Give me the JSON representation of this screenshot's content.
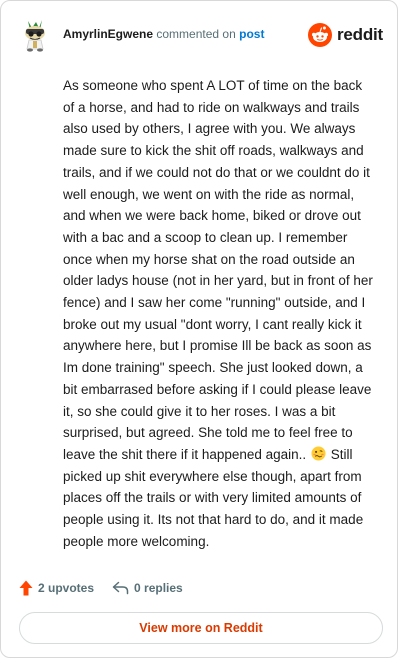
{
  "header": {
    "username": "AmyrlinEgwene",
    "action_text": "commented on",
    "post_link": "post",
    "brand_name": "reddit",
    "brand_color": "#ff4500"
  },
  "avatar": {
    "icon": "snoo-avatar-icon"
  },
  "comment": {
    "body_before_emoji": "As someone who spent A LOT of time on the back of a horse, and had to ride on walkways and trails also used by others, I agree with you. We always made sure to kick the shit off roads, walkways and trails, and if we could not do that or we couldnt do it well enough, we went on with the ride as normal, and when we were back home, biked or drove out with a bac and a scoop to clean up. I remember once when my horse shat on the road outside an older ladys house (not in her yard, but in front of her fence) and I saw her come \"running\" outside, and I broke out my usual \"dont worry, I cant really kick it anywhere here, but I promise Ill be back as soon as Im done training\" speech. She just looked down, a bit embarrased before asking if I could please leave it, so she could give it to her roses. I was a bit surprised, but agreed. She told me to feel free to leave the shit there if it happened again..",
    "emoji_icon": "woozy-face-emoji-icon",
    "body_after_emoji": "Still picked up shit everywhere else though, apart from places off the trails or with very limited amounts of people using it. Its not that hard to do, and it made people more welcoming."
  },
  "actions": {
    "upvotes_label": "2 upvotes",
    "replies_label": "0 replies",
    "upvote_color": "#ff4500",
    "muted_color": "#576f76"
  },
  "view_more": {
    "label": "View more on Reddit",
    "color": "#d93a00"
  }
}
